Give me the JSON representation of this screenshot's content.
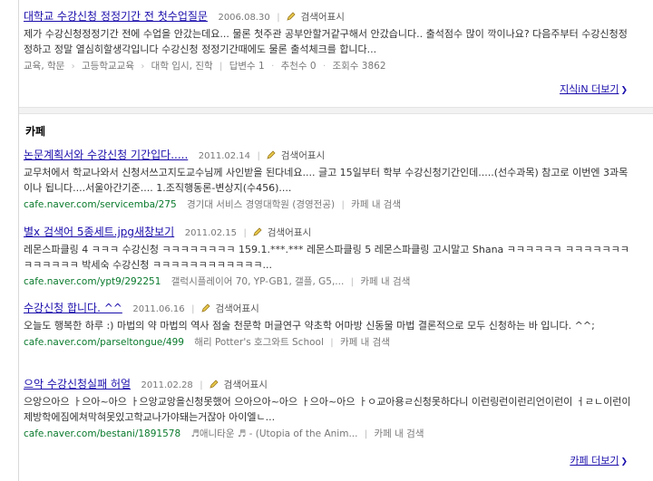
{
  "kin": {
    "item": {
      "title": "대학교 수강신청 정정기간 전 첫수업질문",
      "date": "2006.08.30",
      "memo": "검색어표시",
      "snippet": "제가 수강신청정정기간 전에 수업을 안갔는데요... 물론 첫주관 공부안할거같구해서 안갔습니다.. 출석점수 많이 깍이나요? 다음주부터 수강신청정정하고 정말 열심히할생각입니다 수강신청 정정기간때에도 물론 출석체크를 합니다...",
      "meta": [
        "교육, 학문",
        "고등학교교육",
        "대학 입시, 진학",
        "답변수 1",
        "추천수 0",
        "조회수 3862"
      ]
    },
    "more_label": "지식iN 더보기"
  },
  "cafe": {
    "heading": "카페",
    "items": [
      {
        "title": "논문계획서와 수강신청 기간입다.....",
        "date": "2011.02.14",
        "memo": "검색어표시",
        "snippet": "교무처에서 학교나와서 신청서쓰고지도교수님께 사인받을 된다네요.... 글고 15일부터 학부 수강신청기간인데.....(선수과목) 참고로 이번엔 3과목이나 됩니다....서울아간기준.... 1.조직행동론-변상지(수456)....",
        "url": "cafe.naver.com/servicemba/275",
        "cafe_name": "경기대 서비스 경영대학원 (경영전공)",
        "search_in": "카페 내 검색"
      },
      {
        "title": "별x 검색어 5종세트.jpg새창보기",
        "date": "2011.02.15",
        "memo": "검색어표시",
        "snippet": "레몬스파클링 4 ㅋㅋㅋ 수강신청 ㅋㅋㅋㅋㅋㅋㅋㅋ 159.1.***.*** 레몬스파클링 5 레몬스파클링 고시말고 Shana ㅋㅋㅋㅋㅋㅋ ㅋㅋㅋㅋㅋㅋㅋㅋㅋㅋㅋㅋㅋ 박세숙 수강신청 ㅋㅋㅋㅋㅋㅋㅋㅋㅋㅋㅋㅋ...",
        "url": "cafe.naver.com/ypt9/292251",
        "cafe_name": "갤럭시플레이어 70, YP-GB1, 갤플, G5,...",
        "search_in": "카페 내 검색"
      },
      {
        "title": "수강신청 합니다. ^^",
        "date": "2011.06.16",
        "memo": "검색어표시",
        "snippet": "오늘도 행복한 하루 :) 마법의 약 마법의 역사 점술 천문학 머글연구 약초학 어마방 신동물 마법 결론적으로 모두 신청하는 바 입니다. ^^;",
        "url": "cafe.naver.com/parseltongue/499",
        "cafe_name": "해리 Potter's 호그와트 School",
        "search_in": "카페 내 검색"
      },
      {
        "title": "으악 수강신청실패 허얼",
        "date": "2011.02.28",
        "memo": "검색어표시",
        "snippet": "으앙으아으 ㅏ으아~아으 ㅏ으앙교앙을신청못했어 으아으아~아으 ㅏ으아~아으 ㅏㅇ교아용ㄹ신청못하다니 이런링런이런리언이런이 ㅓㄹㄴ이런이제방학에짐에쳐막혀못있고학교나가야돼는거잖아 아이엘ㄴ...",
        "url": "cafe.naver.com/bestani/1891578",
        "cafe_name": "♬애니타운 ♬ - (Utopia of the Anim...",
        "search_in": "카페 내 검색"
      }
    ],
    "more_label": "카페 더보기"
  }
}
